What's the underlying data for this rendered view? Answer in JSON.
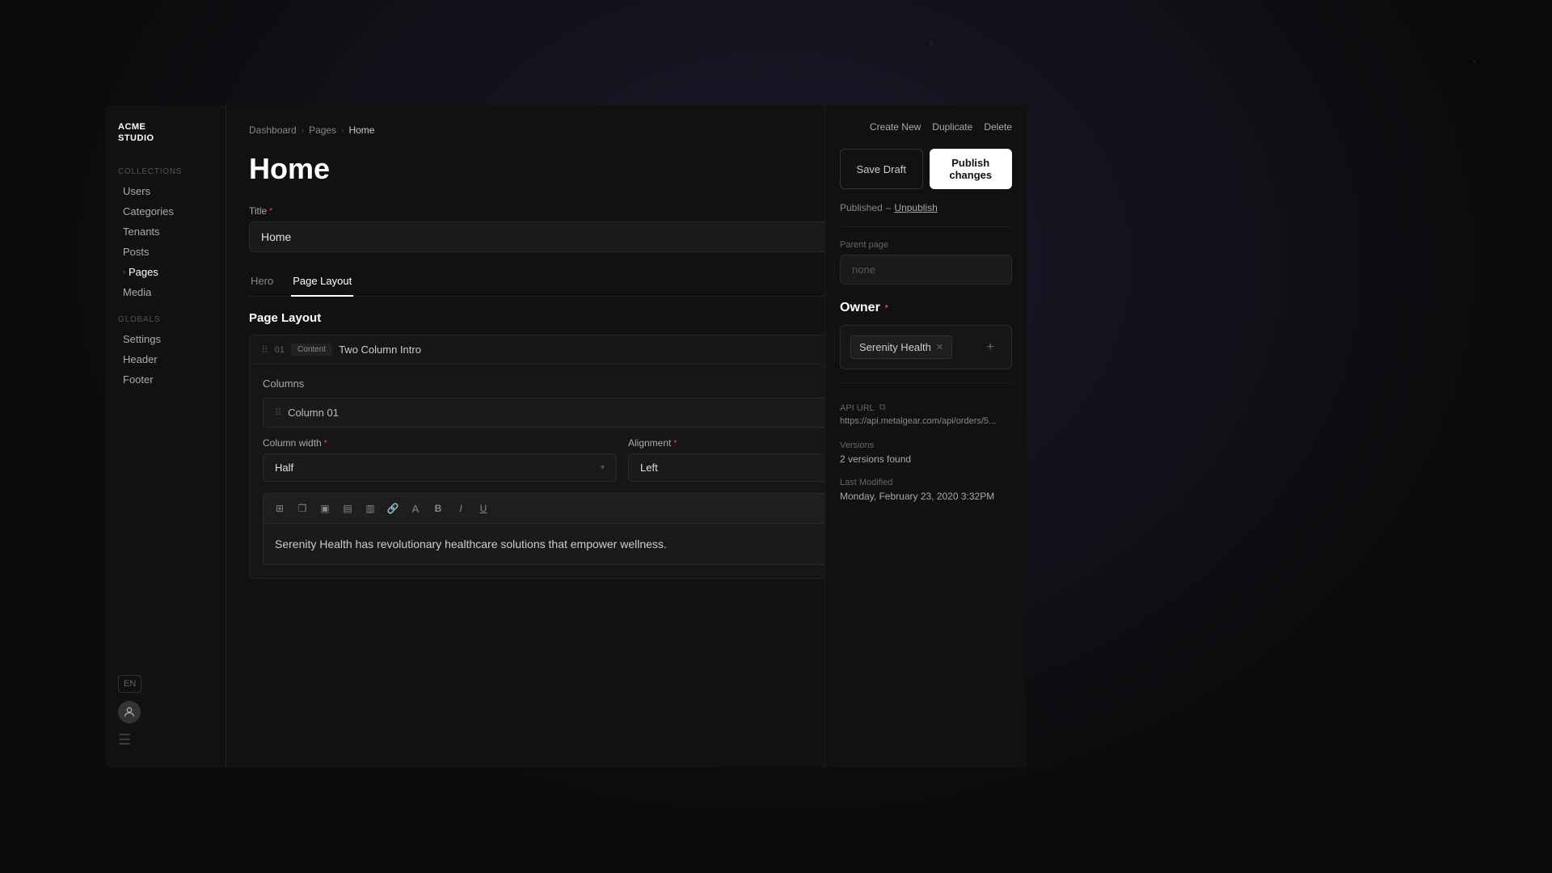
{
  "app": {
    "logo_line1": "ACME",
    "logo_line2": "STUDIO"
  },
  "sidebar": {
    "collections_label": "Collections",
    "items": [
      {
        "id": "users",
        "label": "Users"
      },
      {
        "id": "categories",
        "label": "Categories"
      },
      {
        "id": "tenants",
        "label": "Tenants"
      },
      {
        "id": "posts",
        "label": "Posts"
      },
      {
        "id": "pages",
        "label": "Pages",
        "active": true
      },
      {
        "id": "media",
        "label": "Media"
      }
    ],
    "globals_label": "Globals",
    "global_items": [
      {
        "id": "settings",
        "label": "Settings"
      },
      {
        "id": "header",
        "label": "Header"
      },
      {
        "id": "footer",
        "label": "Footer"
      }
    ],
    "lang": "EN"
  },
  "breadcrumb": {
    "items": [
      {
        "label": "Dashboard",
        "active": false
      },
      {
        "label": "Pages",
        "active": false
      },
      {
        "label": "Home",
        "active": true
      }
    ]
  },
  "page": {
    "title": "Home",
    "title_field_label": "Title",
    "title_field_value": "Home"
  },
  "tabs": [
    {
      "id": "hero",
      "label": "Hero"
    },
    {
      "id": "page-layout",
      "label": "Page Layout",
      "active": true
    }
  ],
  "page_layout": {
    "section_title": "Page Layout",
    "block": {
      "num": "01",
      "type": "Content",
      "name": "Two Column Intro"
    },
    "columns_label": "Columns",
    "column": {
      "name": "Column 01"
    },
    "column_width_label": "Column width",
    "column_width_value": "Half",
    "alignment_label": "Alignment",
    "alignment_value": "Left",
    "toolbar_buttons": [
      "❋",
      "▦",
      "▣",
      "▤",
      "▥",
      "🔗",
      "A",
      "B",
      "I",
      "U"
    ],
    "rich_text": "Serenity Health has revolutionary healthcare solutions that empower wellness."
  },
  "right_panel": {
    "actions": [
      "Create New",
      "Duplicate",
      "Delete"
    ],
    "save_draft_label": "Save Draft",
    "publish_label": "Publish changes",
    "status_text": "Published",
    "unpublish_label": "Unpublish",
    "parent_page_label": "Parent page",
    "parent_page_value": "none",
    "owner_title": "Owner",
    "owner_tag": "Serenity Health",
    "api_url_label": "API URL",
    "api_url_value": "https://api.metalgear.com/api/orders/5...",
    "versions_label": "Versions",
    "versions_count": "2 versions found",
    "last_modified_label": "Last Modified",
    "last_modified_value": "Monday, February 23, 2020 3:32PM"
  }
}
